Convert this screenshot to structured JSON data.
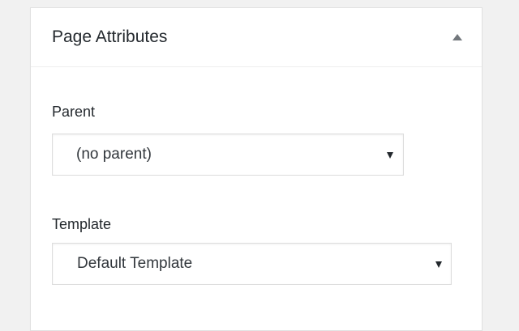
{
  "panel": {
    "title": "Page Attributes",
    "toggle_icon": "triangle-up-icon"
  },
  "parent": {
    "label": "Parent",
    "selected": "(no parent)",
    "arrow_icon": "triangle-down-icon"
  },
  "template": {
    "label": "Template",
    "selected": "Default Template",
    "arrow_icon": "triangle-down-icon"
  },
  "colors": {
    "page_background": "#f1f1f1",
    "panel_background": "#ffffff",
    "border": "#dddddd",
    "text": "#23282d",
    "icon": "#72777c"
  }
}
